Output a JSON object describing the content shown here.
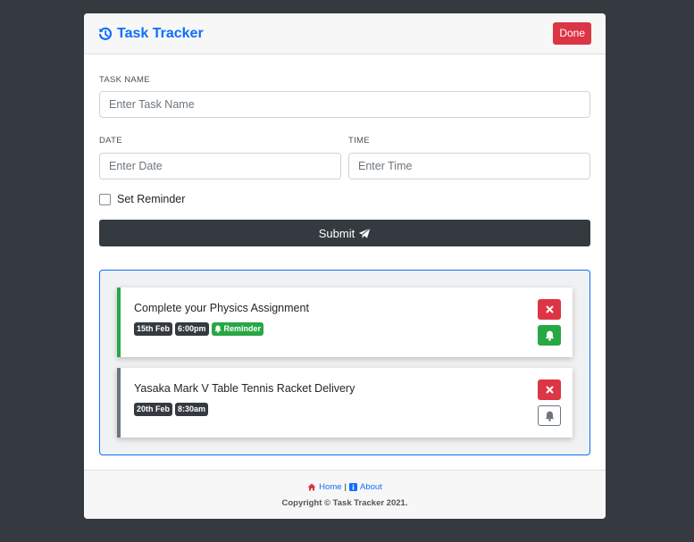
{
  "header": {
    "title": "Task Tracker",
    "done_label": "Done"
  },
  "form": {
    "task_name_label": "TASK NAME",
    "task_name_placeholder": "Enter Task Name",
    "date_label": "DATE",
    "date_placeholder": "Enter Date",
    "time_label": "TIME",
    "time_placeholder": "Enter Time",
    "reminder_label": "Set Reminder",
    "reminder_checked": false,
    "submit_label": "Submit"
  },
  "tasks": [
    {
      "title": "Complete your Physics Assignment",
      "date": "15th Feb",
      "time": "6:00pm",
      "reminder": true,
      "reminder_label": "Reminder"
    },
    {
      "title": "Yasaka Mark V Table Tennis Racket Delivery",
      "date": "20th Feb",
      "time": "8:30am",
      "reminder": false
    }
  ],
  "footer": {
    "home_label": "Home",
    "separator": "|",
    "about_label": "About",
    "copyright": "Copyright © Task Tracker 2021."
  },
  "colors": {
    "primary": "#0d6efd",
    "danger": "#dc3545",
    "success": "#28a745",
    "dark": "#343a40",
    "secondary": "#6c757d"
  },
  "icons": {
    "brand": "history-icon",
    "submit": "paper-plane-icon",
    "delete": "close-icon",
    "reminder": "bell-icon",
    "home": "home-icon",
    "about": "info-icon"
  }
}
